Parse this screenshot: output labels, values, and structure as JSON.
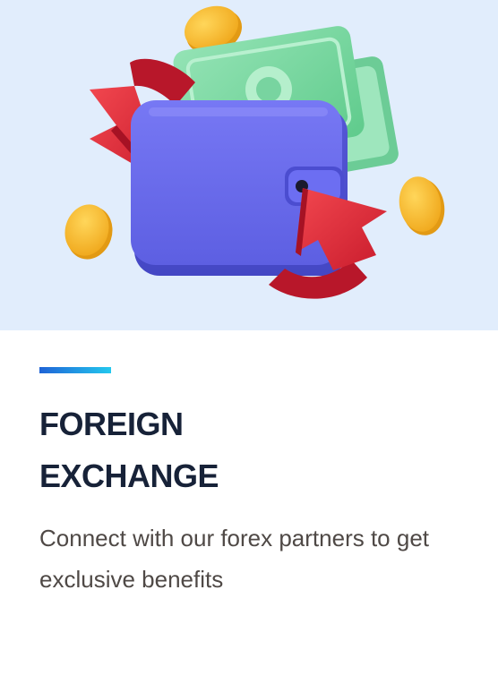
{
  "card": {
    "title_line1": "FOREIGN",
    "title_line2": "EXCHANGE",
    "description": "Connect with our forex partners to get exclusive benefits"
  },
  "hero": {
    "icons": [
      "wallet-icon",
      "banknote-icon",
      "coin-icon",
      "exchange-arrow-icon"
    ]
  },
  "colors": {
    "hero_background": "#e1edfc",
    "accent_start": "#1f63d6",
    "accent_end": "#23c8ee",
    "title": "#172238",
    "description": "#4f4946",
    "wallet": "#6a6cf0",
    "banknote": "#7ed9a4",
    "coin": "#f7bd2c",
    "arrow": "#e5323f"
  }
}
